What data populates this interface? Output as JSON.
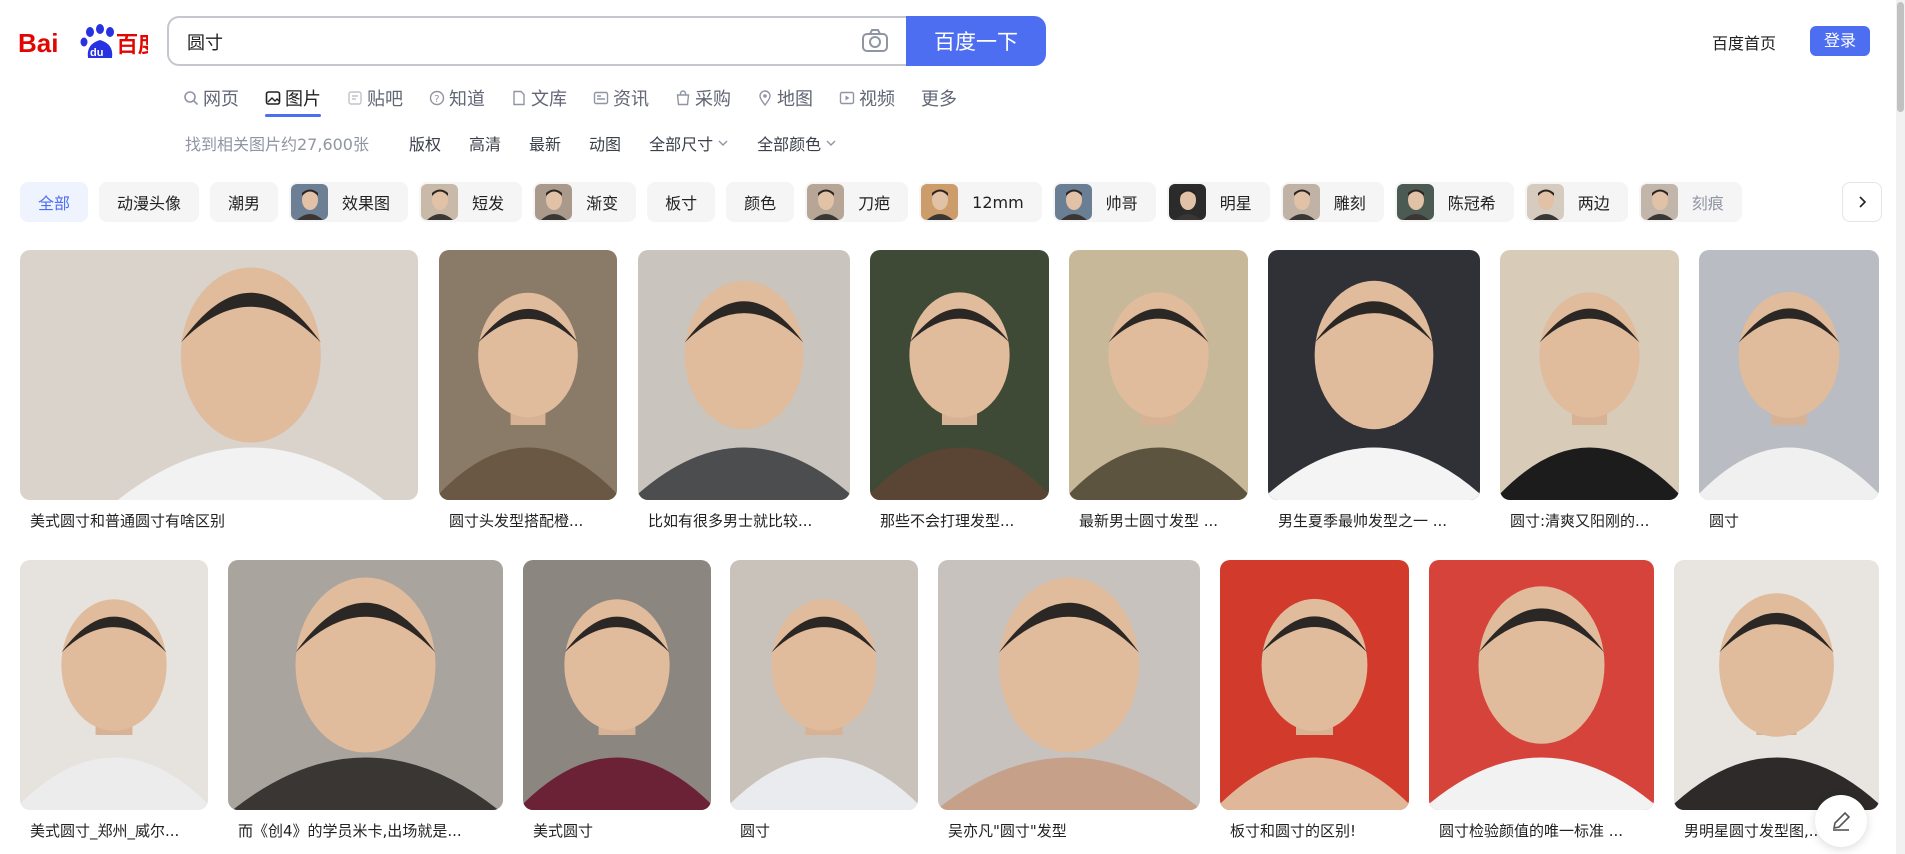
{
  "brand": {
    "logo_text_left": "Bai",
    "logo_text_paw": "du",
    "logo_text_right": "百度"
  },
  "search": {
    "query": "圆寸",
    "button_label": "百度一下"
  },
  "header": {
    "home_link": "百度首页",
    "login_label": "登录"
  },
  "tabs": [
    {
      "label": "网页",
      "icon": "search-icon"
    },
    {
      "label": "图片",
      "icon": "image-icon",
      "active": true
    },
    {
      "label": "贴吧",
      "icon": "tieba-icon"
    },
    {
      "label": "知道",
      "icon": "question-icon"
    },
    {
      "label": "文库",
      "icon": "doc-icon"
    },
    {
      "label": "资讯",
      "icon": "news-icon"
    },
    {
      "label": "采购",
      "icon": "bag-icon"
    },
    {
      "label": "地图",
      "icon": "map-icon"
    },
    {
      "label": "视频",
      "icon": "video-icon"
    },
    {
      "label": "更多"
    }
  ],
  "filters": {
    "result_count": "找到相关图片约27,600张",
    "items": [
      "版权",
      "高清",
      "最新",
      "动图"
    ],
    "size_dropdown": "全部尺寸",
    "color_dropdown": "全部颜色"
  },
  "chips": [
    {
      "label": "全部",
      "active": true
    },
    {
      "label": "动漫头像"
    },
    {
      "label": "潮男"
    },
    {
      "label": "效果图",
      "thumb": true
    },
    {
      "label": "短发",
      "thumb": true
    },
    {
      "label": "渐变",
      "thumb": true
    },
    {
      "label": "板寸"
    },
    {
      "label": "颜色"
    },
    {
      "label": "刀疤",
      "thumb": true
    },
    {
      "label": "12mm",
      "thumb": true
    },
    {
      "label": "帅哥",
      "thumb": true
    },
    {
      "label": "明星",
      "thumb": true
    },
    {
      "label": "雕刻",
      "thumb": true
    },
    {
      "label": "陈冠希",
      "thumb": true
    },
    {
      "label": "两边",
      "thumb": true
    },
    {
      "label": "刻痕",
      "thumb": true
    }
  ],
  "results": [
    {
      "caption": "美式圆寸和普通圆寸有啥区别",
      "bg": "#d9d3cc"
    },
    {
      "caption": "圆寸头发型搭配橙...",
      "bg": "#8a7a68"
    },
    {
      "caption": "比如有很多男士就比较...",
      "bg": "#c9c4bd"
    },
    {
      "caption": "那些不会打理发型...",
      "bg": "#3f4a36"
    },
    {
      "caption": "最新男士圆寸发型 ...",
      "bg": "#c8b89a"
    },
    {
      "caption": "男生夏季最帅发型之一 ...",
      "bg": "#2f3136"
    },
    {
      "caption": "圆寸:清爽又阳刚的...",
      "bg": "#d8cbb8"
    },
    {
      "caption": "圆寸",
      "bg": "#b9bcc2"
    },
    {
      "caption": "美式圆寸_郑州_威尔...",
      "bg": "#e6e3df"
    },
    {
      "caption": "而《创4》的学员米卡,出场就是...",
      "bg": "#a9a49e"
    },
    {
      "caption": "美式圆寸",
      "bg": "#8c8680"
    },
    {
      "caption": "圆寸",
      "bg": "#c9c2bb"
    },
    {
      "caption": "吴亦凡\"圆寸\"发型",
      "bg": "#c7c2bd"
    },
    {
      "caption": "板寸和圆寸的区别!",
      "bg": "#d23a2b"
    },
    {
      "caption": "圆寸检验颜值的唯一标准 ...",
      "bg": "#d6433a"
    },
    {
      "caption": "男明星圆寸发型图,...",
      "bg": "#e8e5e0"
    }
  ]
}
